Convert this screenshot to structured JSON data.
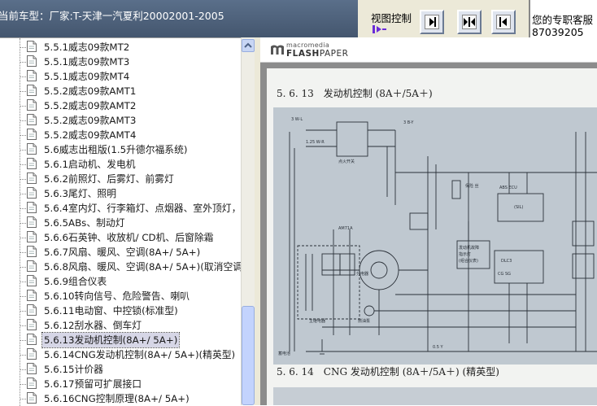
{
  "header": {
    "car_type": "当前车型：厂家:T-天津一汽夏利20002001-2005",
    "view_control_label": "视图控制",
    "service_line1": "您的专职客服",
    "service_line2": "87039205"
  },
  "view_buttons": [
    {
      "name": "show-right"
    },
    {
      "name": "split-both"
    },
    {
      "name": "show-left"
    }
  ],
  "tree": {
    "selected_index": 20,
    "items": [
      "5.5.1威志09款MT2",
      "5.5.1威志09款MT3",
      "5.5.1威志09款MT4",
      "5.5.2威志09款AMT1",
      "5.5.2威志09款AMT2",
      "5.5.2威志09款AMT3",
      "5.5.2威志09款AMT4",
      "5.6威志出租版(1.5升德尔福系统)",
      "5.6.1启动机、发电机",
      "5.6.2前照灯、后雾灯、前雾灯",
      "5.6.3尾灯、照明",
      "5.6.4室内灯、行李箱灯、点烟器、室外顶灯，",
      "5.6.5ABs、制动灯",
      "5.6.6石英钟、收放机/ CD机、后窗除霜",
      "5.6.7风扇、暖风、空调(8A+/ 5A+)",
      "5.6.8风扇、暖风、空调(8A+/ 5A+)(取消空调",
      "5.6.9组合仪表",
      "5.6.10转向信号、危险警告、喇叭",
      "5.6.11电动窗、中控锁(标准型)",
      "5.6.12刮水器、倒车灯",
      "5.6.13发动机控制(8A+/ 5A+)",
      "5.6.14CNG发动机控制(8A+/ 5A+)(精英型)",
      "5.6.15计价器",
      "5.6.17预留可扩展接口",
      "5.6.16CNG控制原理(8A+/ 5A+)"
    ]
  },
  "viewer": {
    "brand_small": "macromedia",
    "brand_flash": "FLASH",
    "brand_paper": "PAPER",
    "section_title": "5. 6. 13　发动机控制 (8A＋/5A＋)",
    "next_section_title": "5. 6. 14　CNG 发动机控制 (8A＋/5A＋) (精英型)"
  },
  "diagram_labels": {
    "ign_switch": "点火开关",
    "abs_ecu": "ABS ECU\n(SIL)",
    "dlc": "DLC3",
    "instrument": "发动机故障\n指示灯\n(组合仪表)",
    "distributor": "分电器",
    "fuel_pump": "燃油泵",
    "main_relay": "主继电器",
    "o2": "氧传感器",
    "cap": "电容器"
  },
  "colors": {
    "titlebar": "#4a5d77",
    "chrome": "#ece9d8",
    "selection": "#d6d6e6",
    "diagram_bg": "#bfc8d0"
  }
}
